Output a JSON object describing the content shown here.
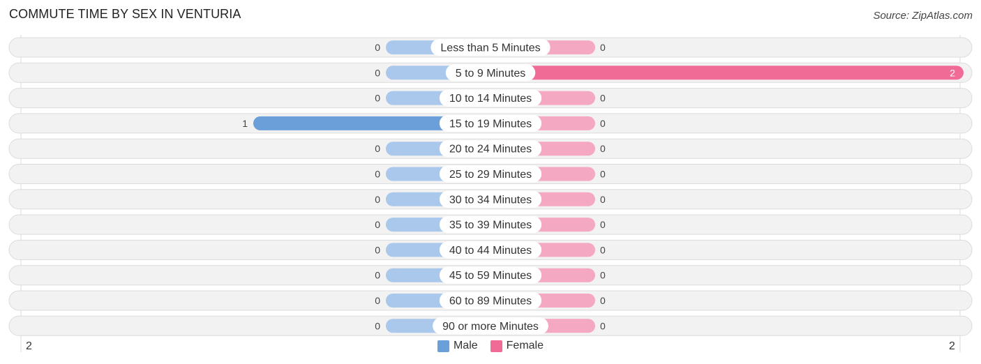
{
  "header": {
    "title": "COMMUTE TIME BY SEX IN VENTURIA",
    "source": "Source: ZipAtlas.com"
  },
  "colors": {
    "male": "#6a9fda",
    "male_light": "#a9c8ec",
    "female": "#f06b96",
    "female_light": "#f5a8c2",
    "row_bg": "#f2f2f2"
  },
  "chart_data": {
    "type": "bar",
    "orientation": "horizontal-diverging",
    "title": "COMMUTE TIME BY SEX IN VENTURIA",
    "categories": [
      "Less than 5 Minutes",
      "5 to 9 Minutes",
      "10 to 14 Minutes",
      "15 to 19 Minutes",
      "20 to 24 Minutes",
      "25 to 29 Minutes",
      "30 to 34 Minutes",
      "35 to 39 Minutes",
      "40 to 44 Minutes",
      "45 to 59 Minutes",
      "60 to 89 Minutes",
      "90 or more Minutes"
    ],
    "series": [
      {
        "name": "Male",
        "values": [
          0,
          0,
          0,
          1,
          0,
          0,
          0,
          0,
          0,
          0,
          0,
          0
        ]
      },
      {
        "name": "Female",
        "values": [
          0,
          2,
          0,
          0,
          0,
          0,
          0,
          0,
          0,
          0,
          0,
          0
        ]
      }
    ],
    "xlim": [
      -2,
      2
    ],
    "axis_tick_labels": {
      "left": "2",
      "right": "2"
    },
    "legend": {
      "entries": [
        "Male",
        "Female"
      ],
      "placement": "bottom-center"
    },
    "grid": false
  }
}
